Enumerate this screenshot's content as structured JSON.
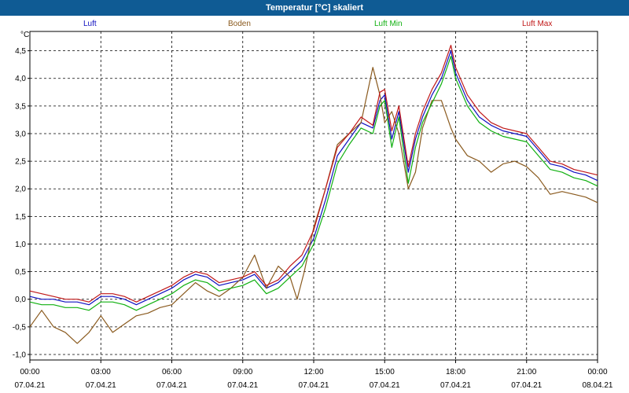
{
  "window": {
    "title": "Temperatur [°C] skaliert"
  },
  "chart_data": {
    "type": "line",
    "title": "Temperatur [°C] skaliert",
    "ylabel": "°C",
    "xlabel": "",
    "ylim": [
      -1.1,
      4.85
    ],
    "xlim": [
      0,
      24
    ],
    "grid": true,
    "legend_position": "top",
    "y_ticks": [
      -1.0,
      -0.5,
      0.0,
      0.5,
      1.0,
      1.5,
      2.0,
      2.5,
      3.0,
      3.5,
      4.0,
      4.5
    ],
    "y_tick_labels": [
      "-1,0",
      "-0,5",
      "0,0",
      "0,5",
      "1,0",
      "1,5",
      "2,0",
      "2,5",
      "3,0",
      "3,5",
      "4,0",
      "4,5"
    ],
    "x_ticks": [
      {
        "hour": 0,
        "time": "00:00",
        "date": "07.04.21"
      },
      {
        "hour": 3,
        "time": "03:00",
        "date": "07.04.21"
      },
      {
        "hour": 6,
        "time": "06:00",
        "date": "07.04.21"
      },
      {
        "hour": 9,
        "time": "09:00",
        "date": "07.04.21"
      },
      {
        "hour": 12,
        "time": "12:00",
        "date": "07.04.21"
      },
      {
        "hour": 15,
        "time": "15:00",
        "date": "07.04.21"
      },
      {
        "hour": 18,
        "time": "18:00",
        "date": "07.04.21"
      },
      {
        "hour": 21,
        "time": "21:00",
        "date": "07.04.21"
      },
      {
        "hour": 24,
        "time": "00:00",
        "date": "08.04.21"
      }
    ],
    "series": [
      {
        "name": "Luft",
        "color": "#1010c0",
        "x": [
          0,
          0.5,
          1,
          1.5,
          2,
          2.5,
          3,
          3.5,
          4,
          4.5,
          5,
          5.5,
          6,
          6.5,
          7,
          7.5,
          8,
          8.5,
          9,
          9.5,
          10,
          10.5,
          11,
          11.5,
          12,
          12.5,
          13,
          13.5,
          14,
          14.5,
          14.8,
          15,
          15.3,
          15.6,
          16,
          16.3,
          16.6,
          17,
          17.4,
          17.8,
          18,
          18.5,
          19,
          19.5,
          20,
          20.5,
          21,
          21.5,
          22,
          22.5,
          23,
          23.5,
          24
        ],
        "y": [
          0.05,
          0.0,
          0.0,
          -0.05,
          -0.05,
          -0.1,
          0.05,
          0.05,
          0.0,
          -0.1,
          0.0,
          0.1,
          0.2,
          0.35,
          0.45,
          0.4,
          0.25,
          0.3,
          0.35,
          0.45,
          0.2,
          0.3,
          0.5,
          0.7,
          1.1,
          1.8,
          2.6,
          2.9,
          3.2,
          3.1,
          3.6,
          3.7,
          2.9,
          3.4,
          2.3,
          2.9,
          3.3,
          3.7,
          4.0,
          4.5,
          4.1,
          3.6,
          3.3,
          3.15,
          3.05,
          3.0,
          2.95,
          2.7,
          2.45,
          2.4,
          2.3,
          2.25,
          2.15
        ]
      },
      {
        "name": "Boden",
        "color": "#8a5a1e",
        "x": [
          0,
          0.5,
          1,
          1.5,
          2,
          2.5,
          3,
          3.5,
          4,
          4.5,
          5,
          5.5,
          6,
          6.5,
          7,
          7.5,
          8,
          8.5,
          9,
          9.5,
          10,
          10.5,
          11,
          11.3,
          11.6,
          12,
          12.5,
          13,
          13.5,
          14,
          14.5,
          14.8,
          15,
          15.3,
          15.6,
          16,
          16.3,
          16.6,
          17,
          17.4,
          17.8,
          18,
          18.5,
          19,
          19.5,
          20,
          20.5,
          21,
          21.5,
          22,
          22.5,
          23,
          23.5,
          24
        ],
        "y": [
          -0.5,
          -0.2,
          -0.5,
          -0.6,
          -0.8,
          -0.6,
          -0.3,
          -0.6,
          -0.45,
          -0.3,
          -0.25,
          -0.15,
          -0.1,
          0.1,
          0.3,
          0.15,
          0.05,
          0.2,
          0.4,
          0.8,
          0.2,
          0.6,
          0.4,
          0.0,
          0.5,
          1.3,
          2.0,
          2.8,
          3.0,
          3.2,
          4.2,
          3.7,
          3.2,
          3.4,
          3.0,
          2.0,
          2.3,
          3.1,
          3.6,
          3.6,
          3.1,
          2.9,
          2.6,
          2.5,
          2.3,
          2.45,
          2.5,
          2.4,
          2.2,
          1.9,
          1.95,
          1.9,
          1.85,
          1.75
        ]
      },
      {
        "name": "Luft Min",
        "color": "#10b010",
        "x": [
          0,
          0.5,
          1,
          1.5,
          2,
          2.5,
          3,
          3.5,
          4,
          4.5,
          5,
          5.5,
          6,
          6.5,
          7,
          7.5,
          8,
          8.5,
          9,
          9.5,
          10,
          10.5,
          11,
          11.5,
          12,
          12.5,
          13,
          13.5,
          14,
          14.5,
          14.8,
          15,
          15.3,
          15.6,
          16,
          16.3,
          16.6,
          17,
          17.4,
          17.8,
          18,
          18.5,
          19,
          19.5,
          20,
          20.5,
          21,
          21.5,
          22,
          22.5,
          23,
          23.5,
          24
        ],
        "y": [
          -0.05,
          -0.1,
          -0.1,
          -0.15,
          -0.15,
          -0.2,
          -0.05,
          -0.05,
          -0.1,
          -0.2,
          -0.1,
          0.0,
          0.1,
          0.25,
          0.35,
          0.3,
          0.15,
          0.2,
          0.25,
          0.35,
          0.1,
          0.2,
          0.4,
          0.6,
          1.0,
          1.65,
          2.45,
          2.8,
          3.1,
          3.0,
          3.5,
          3.6,
          2.75,
          3.3,
          2.1,
          2.75,
          3.2,
          3.55,
          3.9,
          4.4,
          4.0,
          3.5,
          3.2,
          3.05,
          2.95,
          2.9,
          2.85,
          2.6,
          2.35,
          2.3,
          2.2,
          2.15,
          2.05
        ]
      },
      {
        "name": "Luft Max",
        "color": "#c01818",
        "x": [
          0,
          0.5,
          1,
          1.5,
          2,
          2.5,
          3,
          3.5,
          4,
          4.5,
          5,
          5.5,
          6,
          6.5,
          7,
          7.5,
          8,
          8.5,
          9,
          9.5,
          10,
          10.5,
          11,
          11.5,
          12,
          12.5,
          13,
          13.5,
          14,
          14.5,
          14.8,
          15,
          15.3,
          15.6,
          16,
          16.3,
          16.6,
          17,
          17.4,
          17.8,
          18,
          18.5,
          19,
          19.5,
          20,
          20.5,
          21,
          21.5,
          22,
          22.5,
          23,
          23.5,
          24
        ],
        "y": [
          0.15,
          0.1,
          0.05,
          0.0,
          0.0,
          -0.05,
          0.1,
          0.1,
          0.05,
          -0.05,
          0.05,
          0.15,
          0.25,
          0.4,
          0.5,
          0.45,
          0.3,
          0.35,
          0.4,
          0.5,
          0.25,
          0.35,
          0.6,
          0.8,
          1.25,
          2.0,
          2.75,
          3.0,
          3.3,
          3.15,
          3.75,
          3.8,
          3.05,
          3.5,
          2.4,
          3.0,
          3.4,
          3.8,
          4.1,
          4.6,
          4.2,
          3.7,
          3.4,
          3.2,
          3.1,
          3.05,
          3.0,
          2.75,
          2.5,
          2.45,
          2.35,
          2.3,
          2.25
        ]
      }
    ]
  }
}
